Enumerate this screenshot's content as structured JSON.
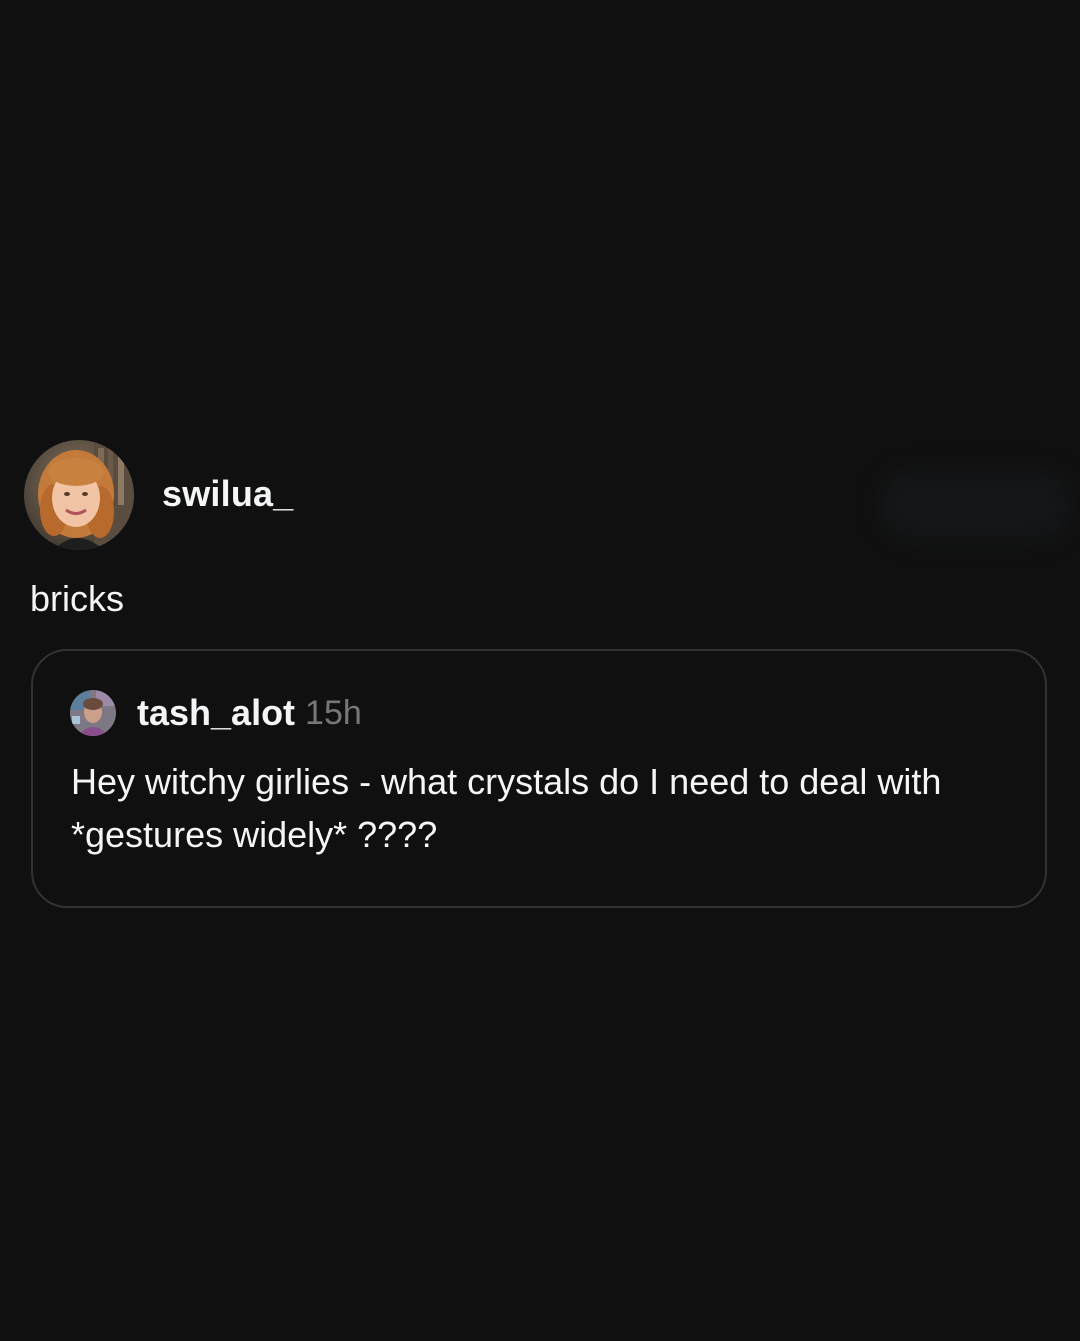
{
  "post": {
    "author": {
      "username": "swilua_",
      "avatar_icon": "profile-photo-avatar"
    },
    "text": "bricks",
    "quoted_post": {
      "username": "tash_alot",
      "time_ago": "15h",
      "avatar_icon": "profile-photo-avatar",
      "text": "Hey witchy girlies - what crystals do I need to deal with *gestures widely* ????"
    }
  },
  "colors": {
    "background": "#101010",
    "primary_text": "#f3f5f7",
    "secondary_text": "#777777",
    "card_border": "#323232"
  }
}
